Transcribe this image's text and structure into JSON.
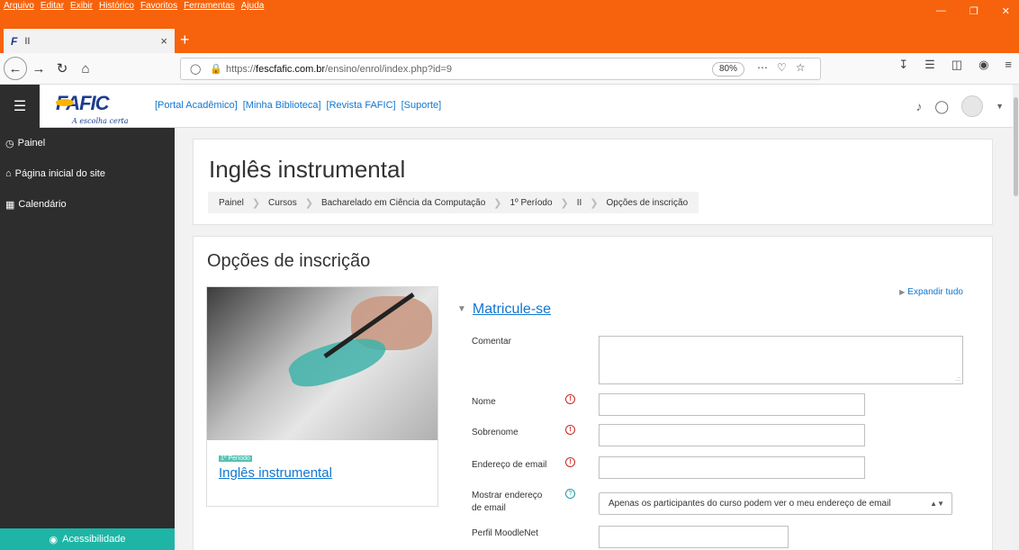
{
  "browser": {
    "menu": [
      "Arquivo",
      "Editar",
      "Exibir",
      "Histórico",
      "Favoritos",
      "Ferramentas",
      "Ajuda"
    ],
    "tab_title": "II",
    "tab_close": "×",
    "new_tab": "+",
    "url_prefix": "https://",
    "url_domain": "fescfafic.com.br",
    "url_path": "/ensino/enrol/index.php?id=9",
    "zoom": "80%",
    "window_controls": [
      "—",
      "❐",
      "✕"
    ]
  },
  "header": {
    "brand": "FAFIC",
    "tagline": "A escolha certa",
    "nav_links": [
      "[Portal Acadêmico]",
      "[Minha Biblioteca]",
      "[Revista FAFIC]",
      "[Suporte]"
    ]
  },
  "drawer": {
    "items": [
      {
        "icon": "gauge-icon",
        "label": "Painel"
      },
      {
        "icon": "home-icon",
        "label": "Página inicial do site"
      },
      {
        "icon": "calendar-icon",
        "label": "Calendário"
      }
    ],
    "accessibility": "Acessibilidade"
  },
  "course_header": {
    "title": "Inglês instrumental",
    "breadcrumb": [
      "Painel",
      "Cursos",
      "Bacharelado em Ciência da Computação",
      "1º Período",
      "II",
      "Opções de inscrição"
    ]
  },
  "enrol": {
    "title": "Opções de inscrição",
    "course_badge": "1º Período",
    "course_name": "Inglês instrumental",
    "expand_all": "Expandir tudo",
    "section": "Matricule-se",
    "fields": {
      "comment_label": "Comentar",
      "first_name_label": "Nome",
      "last_name_label": "Sobrenome",
      "email_label": "Endereço de email",
      "show_email_label": "Mostrar endereço de email",
      "show_email_value": "Apenas os participantes do curso podem ver o meu endereço de email",
      "moodlenet_label": "Perfil MoodleNet"
    }
  },
  "colors": {
    "browser_accent": "#f7630c",
    "link": "#1177d1",
    "drawer_bg": "#2d2d2d",
    "accessibility_bg": "#1fb5a6",
    "required": "#cc2222"
  }
}
